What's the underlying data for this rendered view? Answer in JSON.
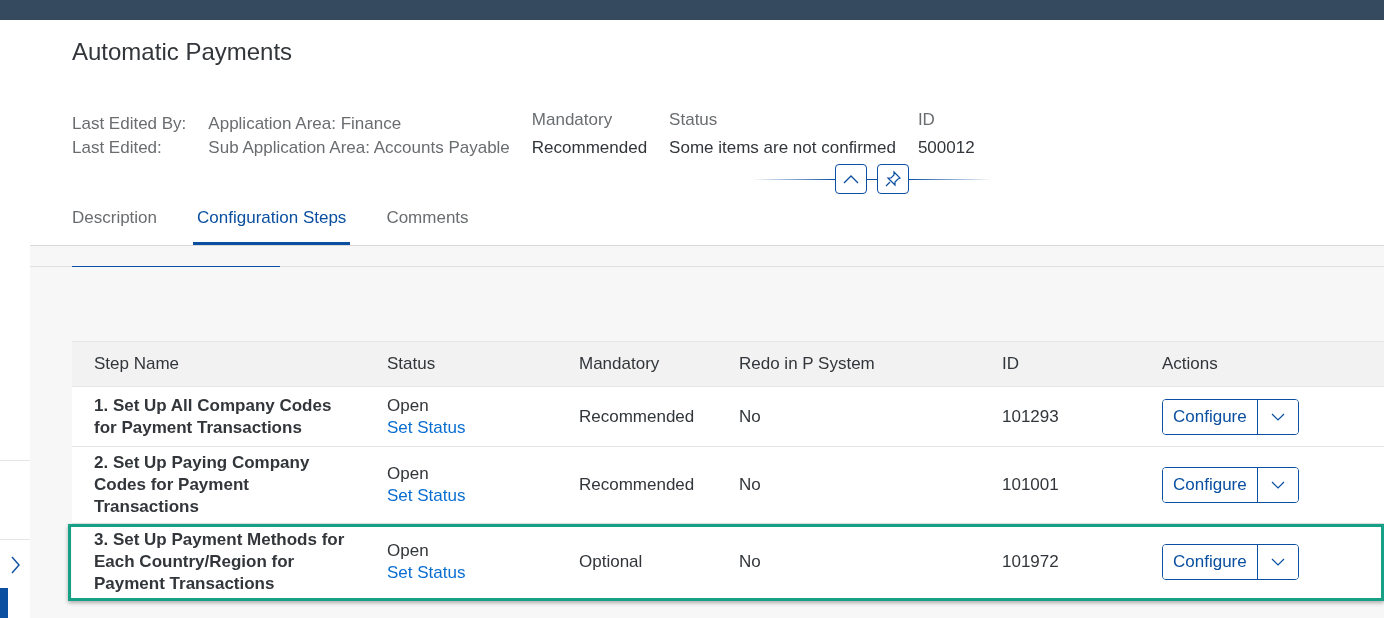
{
  "title": "Automatic Payments",
  "edit_labels": [
    "Last Edited By:",
    "Last Edited:"
  ],
  "areas": [
    "Application Area: Finance",
    "Sub Application Area: Accounts Payable"
  ],
  "facets": [
    {
      "label": "Mandatory",
      "value": "Recommended"
    },
    {
      "label": "Status",
      "value": "Some items are not confirmed"
    },
    {
      "label": "ID",
      "value": "500012"
    }
  ],
  "tabs": [
    {
      "label": "Description",
      "selected": false
    },
    {
      "label": "Configuration Steps",
      "selected": true
    },
    {
      "label": "Comments",
      "selected": false
    }
  ],
  "table": {
    "columns": [
      "Step Name",
      "Status",
      "Mandatory",
      "Redo in P System",
      "ID",
      "Actions"
    ],
    "rows": [
      {
        "step": "1. Set Up All Company Codes for Payment Transactions",
        "status": "Open",
        "status_link": "Set Status",
        "mandatory": "Recommended",
        "redo": "No",
        "id": "101293",
        "action": "Configure",
        "highlighted": false
      },
      {
        "step": "2. Set Up Paying Company Codes for Payment Transactions",
        "status": "Open",
        "status_link": "Set Status",
        "mandatory": "Recommended",
        "redo": "No",
        "id": "101001",
        "action": "Configure",
        "highlighted": false
      },
      {
        "step": "3. Set Up Payment Methods for Each Country/Region for Payment Transactions",
        "status": "Open",
        "status_link": "Set Status",
        "mandatory": "Optional",
        "redo": "No",
        "id": "101972",
        "action": "Configure",
        "highlighted": true
      }
    ]
  }
}
